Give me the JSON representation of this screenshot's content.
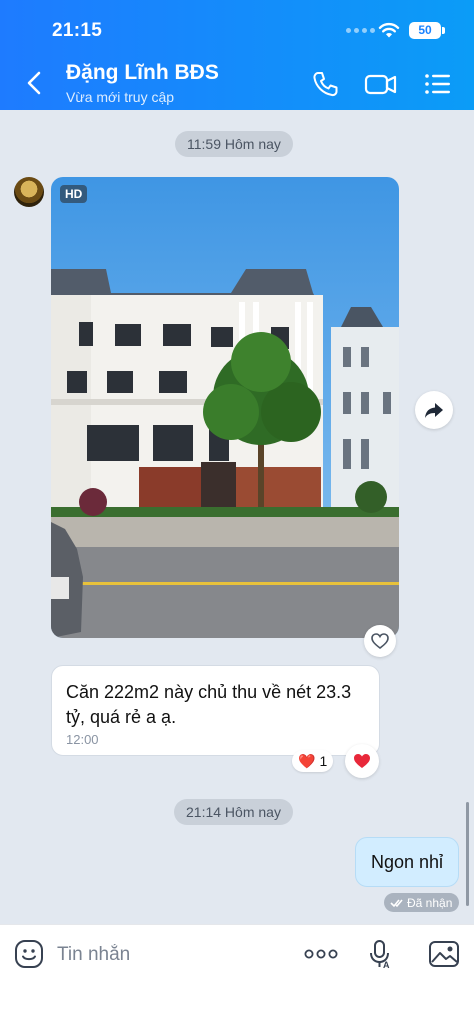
{
  "status_bar": {
    "time": "21:15",
    "battery": "50"
  },
  "header": {
    "contact_name": "Đặng Lĩnh BĐS",
    "contact_status": "Vừa mới truy cập",
    "icons": [
      "back-icon",
      "phone-icon",
      "video-call-icon",
      "menu-icon"
    ]
  },
  "chat": {
    "separators": [
      "11:59 Hôm nay",
      "21:14 Hôm nay"
    ],
    "image_message": {
      "badge": "HD"
    },
    "incoming_message": {
      "text": "Căn 222m2 này chủ thu về nét 23.3 tỷ, quá rẻ a ạ.",
      "time": "12:00",
      "reaction_emoji": "❤️",
      "reaction_count": "1"
    },
    "outgoing_message": {
      "text": "Ngon nhỉ",
      "status": "Đã nhận"
    }
  },
  "composer": {
    "placeholder": "Tin nhắn",
    "icons": [
      "emoji-icon",
      "more-icon",
      "mic-icon",
      "image-icon"
    ]
  },
  "colors": {
    "header_gradient_start": "#1e7bff",
    "header_gradient_end": "#0b9cf7",
    "chat_bg": "#e2e8f0",
    "outgoing_bubble": "#d2edff",
    "heart": "#e8283a"
  }
}
